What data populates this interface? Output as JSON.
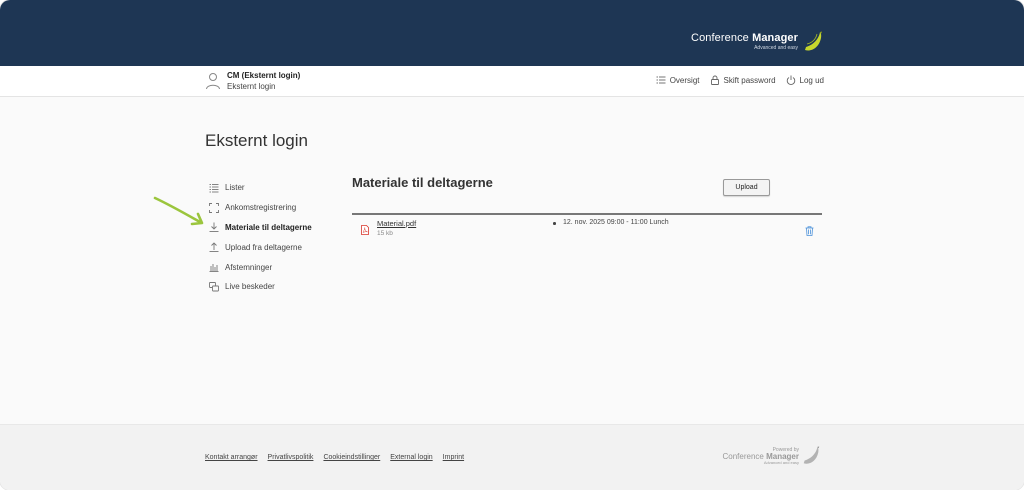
{
  "brand": {
    "name_light": "Conference ",
    "name_bold": "Manager",
    "tagline": "Advanced and easy",
    "logo_color": "#c6d72d"
  },
  "user": {
    "name": "CM (Eksternt login)",
    "role": "Eksternt login"
  },
  "topnav": {
    "overview": "Oversigt",
    "change_password": "Skift password",
    "logout": "Log ud"
  },
  "page": {
    "title": "Eksternt login"
  },
  "sidenav": {
    "items": [
      {
        "label": "Lister",
        "icon": "list-icon"
      },
      {
        "label": "Ankomstregistrering",
        "icon": "scan-icon"
      },
      {
        "label": "Materiale til deltagerne",
        "icon": "download-icon",
        "active": true
      },
      {
        "label": "Upload fra deltagerne",
        "icon": "upload-icon"
      },
      {
        "label": "Afstemninger",
        "icon": "bar-chart-icon"
      },
      {
        "label": "Live beskeder",
        "icon": "chat-icon"
      }
    ]
  },
  "content": {
    "title": "Materiale til deltagerne",
    "upload_label": "Upload",
    "files": [
      {
        "name": "Material.pdf",
        "size": "15 kb",
        "session": "12. nov. 2025 09:00 - 11:00 Lunch"
      }
    ]
  },
  "footer": {
    "links": [
      "Kontakt arrangør",
      "Privatlivspolitik",
      "Cookieindstillinger",
      "External login",
      "Imprint"
    ],
    "powered_by": "Powered by",
    "powered_name_light": "Conference ",
    "powered_name_bold": "Manager",
    "powered_tagline": "Advanced and easy"
  },
  "colors": {
    "header_bg": "#1e3654",
    "arrow": "#9bc53d",
    "pdf_red": "#d9342b",
    "trash_blue": "#4a90d9"
  }
}
